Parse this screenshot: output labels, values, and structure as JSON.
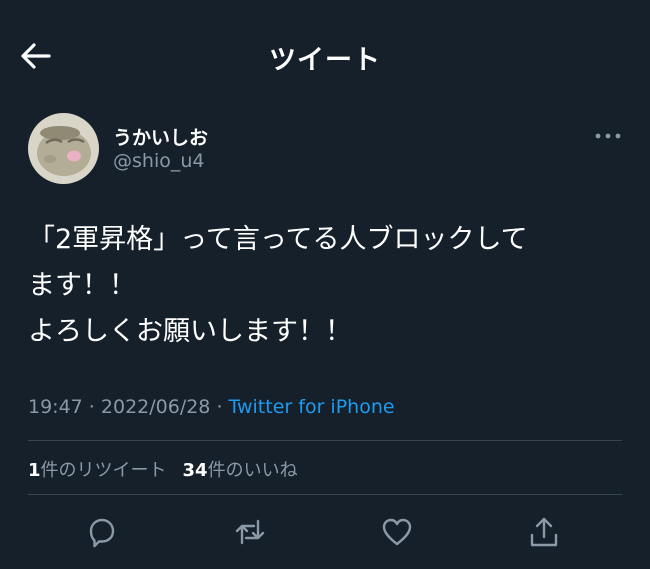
{
  "header": {
    "title": "ツイート",
    "back_icon": "arrow-left-icon"
  },
  "user": {
    "display_name": "うかいしお",
    "handle": "@shio_u4",
    "avatar_icon": "avatar-image"
  },
  "tweet": {
    "text": "「2軍昇格」って言ってる人ブロックして\nます！！\nよろしくお願いします！！",
    "time": "19:47",
    "separator": " · ",
    "date": "2022/06/28",
    "source": "Twitter for iPhone"
  },
  "stats": {
    "retweets_count": "1",
    "retweets_label": "件のリツイート",
    "likes_count": "34",
    "likes_label": "件のいいね"
  },
  "actions": [
    "reply-icon",
    "retweet-icon",
    "like-icon",
    "share-icon"
  ],
  "colors": {
    "background": "#15202b",
    "text": "#ffffff",
    "secondary": "#8b98a5",
    "link": "#1d9bf0",
    "divider": "#38444d"
  }
}
